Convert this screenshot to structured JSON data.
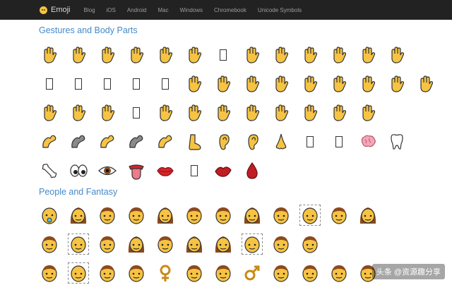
{
  "brand": {
    "name": "Emoji",
    "icon": "smiley-icon"
  },
  "nav": {
    "links": [
      "Blog",
      "iOS",
      "Android",
      "Mac",
      "Windows",
      "Chromebook",
      "Unicode Symbols"
    ]
  },
  "sections": [
    {
      "title": "Gestures and Body Parts",
      "rows": [
        [
          "hand",
          "hand",
          "hand",
          "hand",
          "hand",
          "hand",
          "tofu",
          "hand",
          "hand",
          "hand",
          "hand",
          "hand",
          "hand"
        ],
        [
          "tofu",
          "tofu",
          "tofu",
          "tofu",
          "tofu",
          "hand",
          "hand",
          "hand",
          "hand",
          "hand",
          "hand",
          "hand",
          "hand",
          "hand"
        ],
        [
          "hand",
          "hand",
          "hand",
          "tofu",
          "hand",
          "hand",
          "hand",
          "hand",
          "hand",
          "hand",
          "hand",
          "hand"
        ],
        [
          "limb",
          "limb-gray",
          "limb",
          "limb-gray",
          "limb",
          "foot",
          "ear",
          "ear",
          "nose",
          "tofu",
          "tofu",
          "brain",
          "tooth"
        ],
        [
          "bone",
          "eyes",
          "eye",
          "tongue",
          "lips",
          "tofu",
          "kiss",
          "drop"
        ]
      ]
    },
    {
      "title": "People and Fantasy",
      "rows": [
        [
          "baby",
          "face-f",
          "face",
          "face",
          "face-f",
          "face",
          "face",
          "face-f",
          "face",
          "face-dashed",
          "face",
          "face-f"
        ],
        [
          "face",
          "face-dashed",
          "face",
          "face-f",
          "face",
          "face-f",
          "face-f",
          "face-dashed",
          "face",
          "face"
        ],
        [
          "face",
          "face-dashed",
          "face",
          "face",
          "female-sign",
          "face",
          "face",
          "male-sign",
          "face",
          "face",
          "face",
          "face"
        ]
      ]
    }
  ],
  "watermark": "头条 @资源趣分享",
  "colors": {
    "navbar": "#222222",
    "link": "#428bca",
    "skin": "#f6c343",
    "skin_dark": "#e0a82e",
    "hair": "#8b4a1e",
    "red": "#d4242a"
  }
}
